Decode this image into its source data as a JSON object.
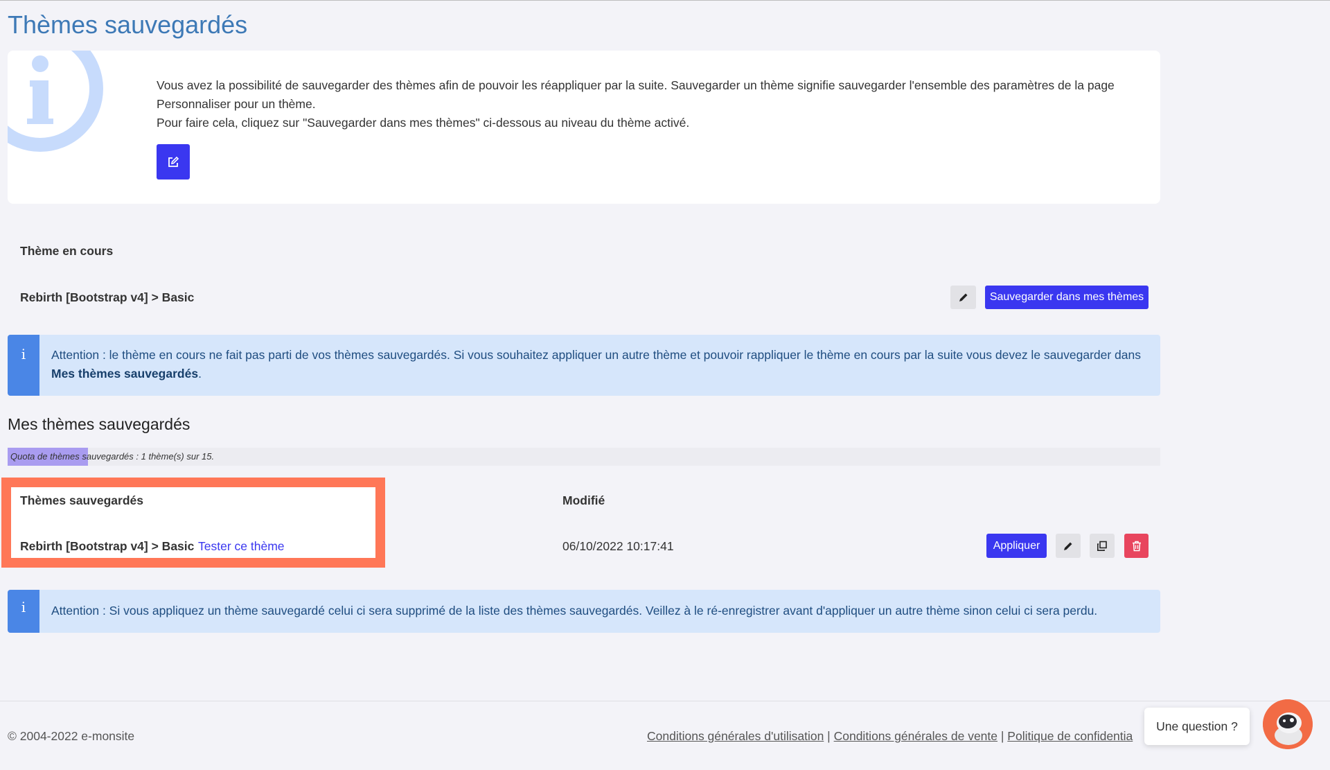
{
  "page": {
    "title": "Thèmes sauvegardés"
  },
  "info": {
    "line1": "Vous avez la possibilité de sauvegarder des thèmes afin de pouvoir les réappliquer par la suite. Sauvegarder un thème signifie sauvegarder l'ensemble des paramètres de la page Personnaliser pour un thème.",
    "line2": "Pour faire cela, cliquez sur \"Sauvegarder dans mes thèmes\" ci-dessous au niveau du thème activé.",
    "edit_icon": "edit-square-icon"
  },
  "current_theme": {
    "heading": "Thème en cours",
    "name": "Rebirth [Bootstrap v4] > Basic",
    "save_label": "Sauvegarder dans mes thèmes",
    "edit_icon": "pencil-icon"
  },
  "alert1": {
    "icon": "i",
    "text_before": "Attention : le thème en cours ne fait pas parti de vos thèmes sauvegardés. Si vous souhaitez appliquer un autre thème et pouvoir rappliquer le thème en cours par la suite vous devez le sauvegarder dans ",
    "strong": "Mes thèmes sauvegardés",
    "text_after": "."
  },
  "saved": {
    "section_title": "Mes thèmes sauvegardés",
    "quota_text": "Quota de thèmes sauvegardés : 1 thème(s) sur 15.",
    "quota_used": 1,
    "quota_total": 15,
    "col_name": "Thèmes sauvegardés",
    "col_modified": "Modifié",
    "rows": [
      {
        "name": "Rebirth [Bootstrap v4] > Basic",
        "test_link": "Tester ce thème",
        "modified": "06/10/2022 10:17:41",
        "apply_label": "Appliquer"
      }
    ],
    "highlight_color": "#ff7757"
  },
  "alert2": {
    "icon": "i",
    "text": "Attention : Si vous appliquez un thème sauvegardé celui ci sera supprimé de la liste des thèmes sauvegardés. Veillez à le ré-enregistrer avant d'appliquer un autre thème sinon celui ci sera perdu."
  },
  "footer": {
    "copyright": "© 2004-2022 e-monsite",
    "links": [
      "Conditions générales d'utilisation",
      "Conditions générales de vente",
      "Politique de confidentia"
    ],
    "separator": " | "
  },
  "chat": {
    "bubble": "Une question ?"
  },
  "colors": {
    "primary": "#3a37f0",
    "title": "#3d79b6",
    "danger": "#e8455e",
    "alert_bg": "#d6e6fb",
    "alert_bar": "#4a86e6"
  }
}
